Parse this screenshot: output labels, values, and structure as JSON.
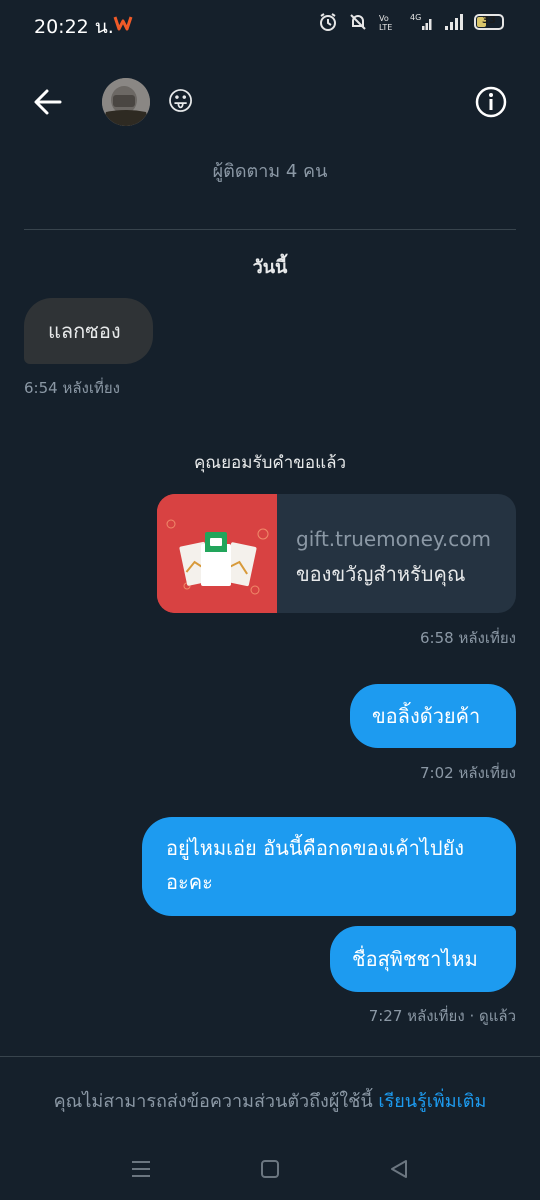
{
  "status_bar": {
    "time": "20:22 น.",
    "battery": "33",
    "network": "4G"
  },
  "header": {
    "followers": "ผู้ติดตาม 4 คน",
    "emoji": "😛"
  },
  "day_label": "วันนี้",
  "messages": [
    {
      "text": "แลกซอง",
      "time": "6:54 หลังเที่ยง"
    },
    {
      "text": "ขอลิ้งด้วยค้า",
      "time": "7:02 หลังเที่ยง"
    },
    {
      "text_line1": "อยู่ไหมเอ่ย อันนี้คือกดของเค้าไปยัง",
      "text_line2": "อะคะ"
    },
    {
      "text": "ชื่อสุพิชชาไหม",
      "time": "7:27 หลังเที่ยง · ดูแล้ว"
    }
  ],
  "system_note": "คุณยอมรับคำขอแล้ว",
  "gift_card": {
    "domain": "gift.truemoney.com",
    "title": "ของขวัญสำหรับคุณ",
    "time": "6:58 หลังเที่ยง"
  },
  "footer": {
    "note": "คุณไม่สามารถส่งข้อความส่วนตัวถึงผู้ใช้นี้ ",
    "link": "เรียนรู้เพิ่มเติม"
  },
  "colors": {
    "background": "#15202b",
    "accent": "#1d9bf0",
    "incoming_bubble": "#2f3336",
    "muted_text": "#8b98a5"
  },
  "icons": [
    "back-arrow-icon",
    "info-icon",
    "alarm-icon",
    "mute-icon",
    "volte-icon",
    "signal-icon",
    "battery-icon",
    "menu-icon",
    "home-icon",
    "back-icon"
  ]
}
